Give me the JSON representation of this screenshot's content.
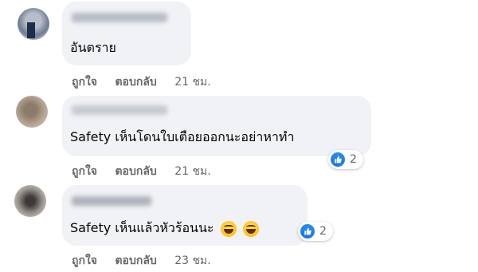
{
  "comments": [
    {
      "text": "อันตราย",
      "like_label": "ถูกใจ",
      "reply_label": "ตอบกลับ",
      "time": "21 ชม."
    },
    {
      "text": "Safety เห็นโดนใบเตือยออกนะอย่าหาทำ",
      "like_label": "ถูกใจ",
      "reply_label": "ตอบกลับ",
      "time": "21 ชม.",
      "reaction_icon": "like-icon",
      "reaction_count": "2"
    },
    {
      "text": "Safety เห็นแล้วหัวร้อนนะ",
      "emoji": [
        "laughing-emoji",
        "laughing-emoji"
      ],
      "like_label": "ถูกใจ",
      "reply_label": "ตอบกลับ",
      "time": "23 ชม.",
      "reaction_icon": "like-icon",
      "reaction_count": "2"
    }
  ],
  "colors": {
    "bubble": "#f0f2f5",
    "secondary_text": "#65676b",
    "like_blue": "#1877f2"
  }
}
